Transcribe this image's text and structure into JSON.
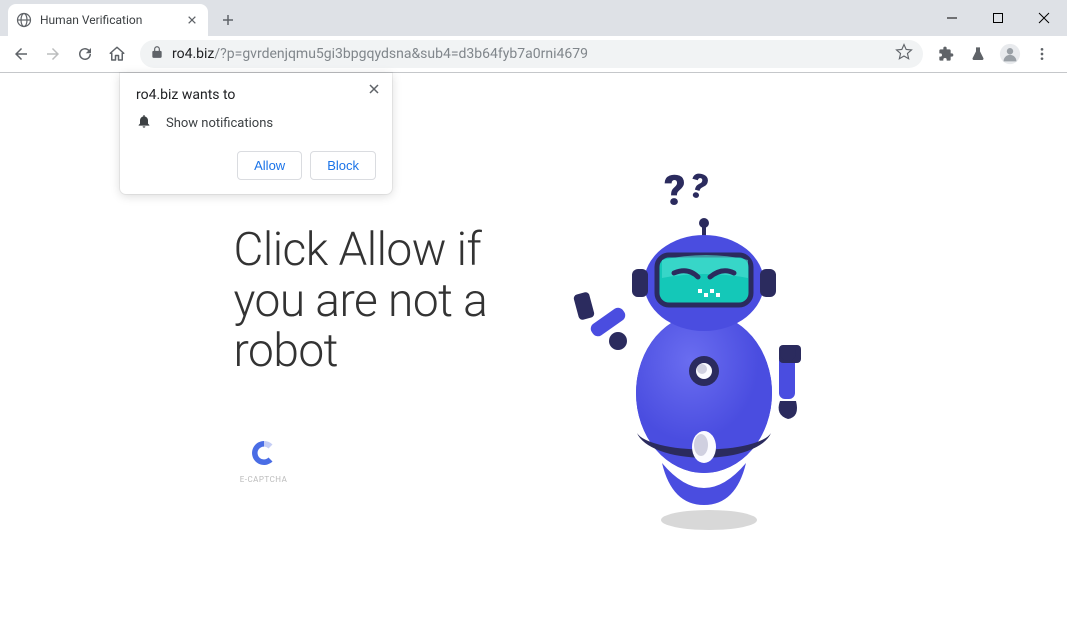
{
  "tab": {
    "title": "Human Verification"
  },
  "url": {
    "domain": "ro4.biz",
    "path": "/?p=gvrdenjqmu5gi3bpgqydsna&sub4=d3b64fyb7a0rni4679"
  },
  "permission": {
    "title": "ro4.biz wants to",
    "request": "Show notifications",
    "allow": "Allow",
    "block": "Block"
  },
  "page": {
    "headline": "Click Allow if you are not a robot",
    "captcha_label": "E-CAPTCHA"
  }
}
